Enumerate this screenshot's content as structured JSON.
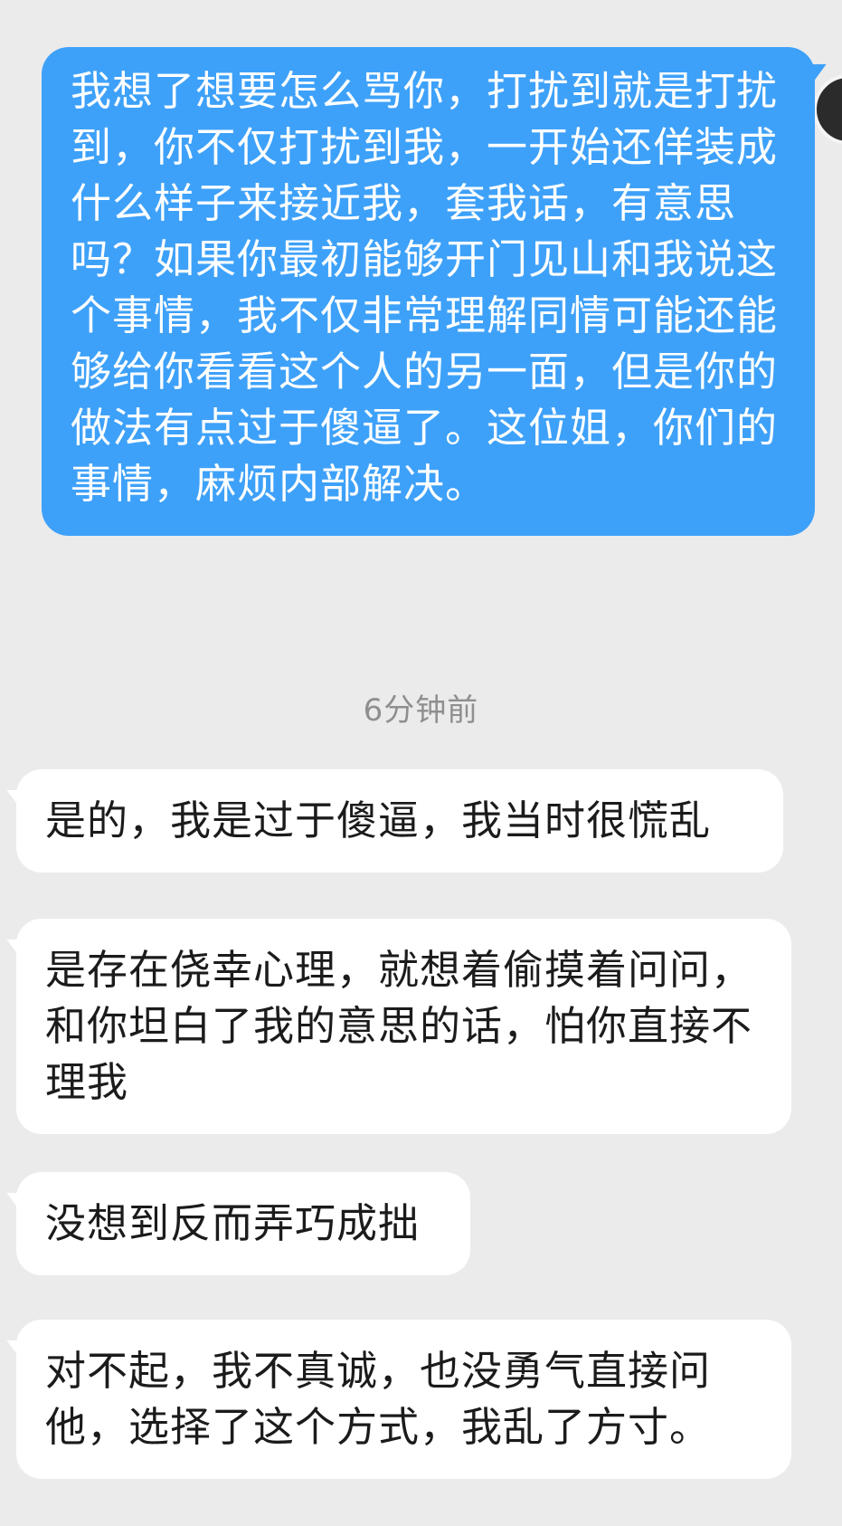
{
  "chat": {
    "header_partial": "…",
    "outgoing_message": "我想了想要怎么骂你，打扰到就是打扰到，你不仅打扰到我，一开始还佯装成什么样子来接近我，套我话，有意思吗？如果你最初能够开门见山和我说这个事情，我不仅非常理解同情可能还能够给你看看这个人的另一面，但是你的做法有点过于傻逼了。这位姐，你们的事情，麻烦内部解决。",
    "timestamp": "6分钟前",
    "incoming_messages": [
      "是的，我是过于傻逼，我当时很慌乱",
      "是存在侥幸心理，就想着偷摸着问问，和你坦白了我的意思的话，怕你直接不理我",
      "没想到反而弄巧成拙",
      "对不起，我不真诚，也没勇气直接问他，选择了这个方式，我乱了方寸。"
    ]
  },
  "colors": {
    "background": "#ebebeb",
    "outgoing_bubble": "#3ea1f9",
    "incoming_bubble": "#ffffff",
    "timestamp_text": "#8f8f8f"
  }
}
